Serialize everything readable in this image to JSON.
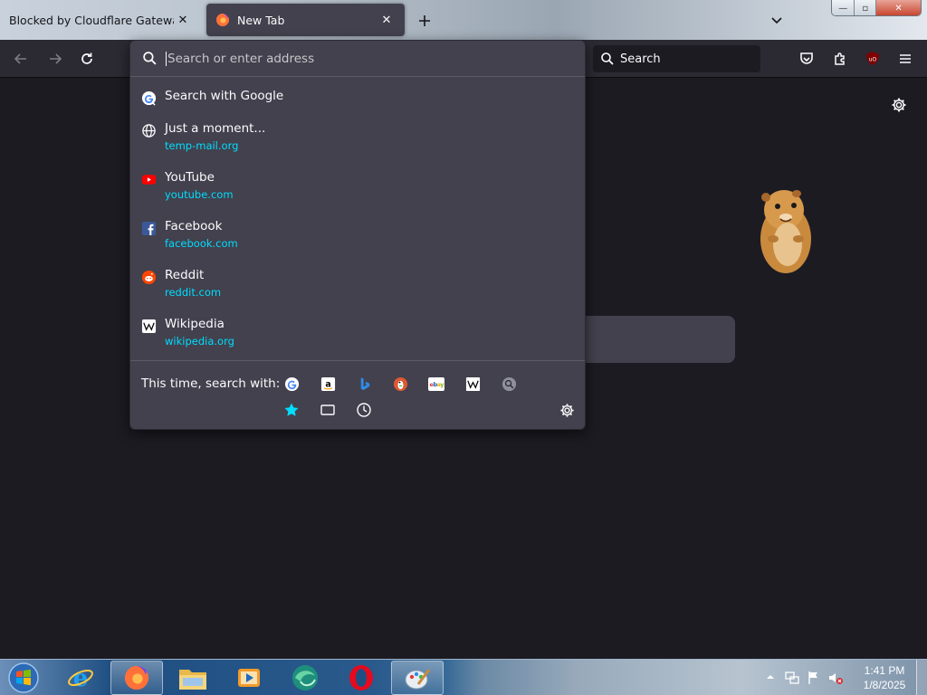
{
  "tabs": [
    {
      "title": "Blocked by Cloudflare Gateway",
      "active": false
    },
    {
      "title": "New Tab",
      "active": true
    }
  ],
  "window_controls": {
    "minimize": "—",
    "maximize": "▫",
    "close": "✕"
  },
  "toolbar": {
    "search_placeholder": "Search"
  },
  "urlbar": {
    "placeholder": "Search or enter address",
    "value": ""
  },
  "results": [
    {
      "title": "Search with Google",
      "url": "",
      "icon": "google-icon"
    },
    {
      "title": "Just a moment...",
      "url": "temp-mail.org",
      "icon": "globe-icon"
    },
    {
      "title": "YouTube",
      "url": "youtube.com",
      "icon": "youtube-icon"
    },
    {
      "title": "Facebook",
      "url": "facebook.com",
      "icon": "facebook-icon"
    },
    {
      "title": "Reddit",
      "url": "reddit.com",
      "icon": "reddit-icon"
    },
    {
      "title": "Wikipedia",
      "url": "wikipedia.org",
      "icon": "wikipedia-icon"
    }
  ],
  "oneoff": {
    "label": "This time, search with:",
    "engines": [
      "google-icon",
      "amazon-icon",
      "bing-icon",
      "duckduckgo-icon",
      "ebay-icon",
      "wikipedia-icon",
      "search-engine-icon"
    ],
    "modes": [
      "bookmarks-icon",
      "tabs-icon",
      "history-icon"
    ]
  },
  "taskbar": {
    "apps": [
      "internet-explorer-icon",
      "firefox-icon",
      "file-explorer-icon",
      "media-player-icon",
      "browser-icon",
      "opera-icon",
      "paint-icon"
    ]
  },
  "clock": {
    "time": "1:41 PM",
    "date": "1/8/2025"
  },
  "colors": {
    "accent_link": "#00ddff",
    "popup_bg": "#42414d",
    "page_bg": "#1c1b22",
    "toolbar_bg": "#2b2a33"
  }
}
